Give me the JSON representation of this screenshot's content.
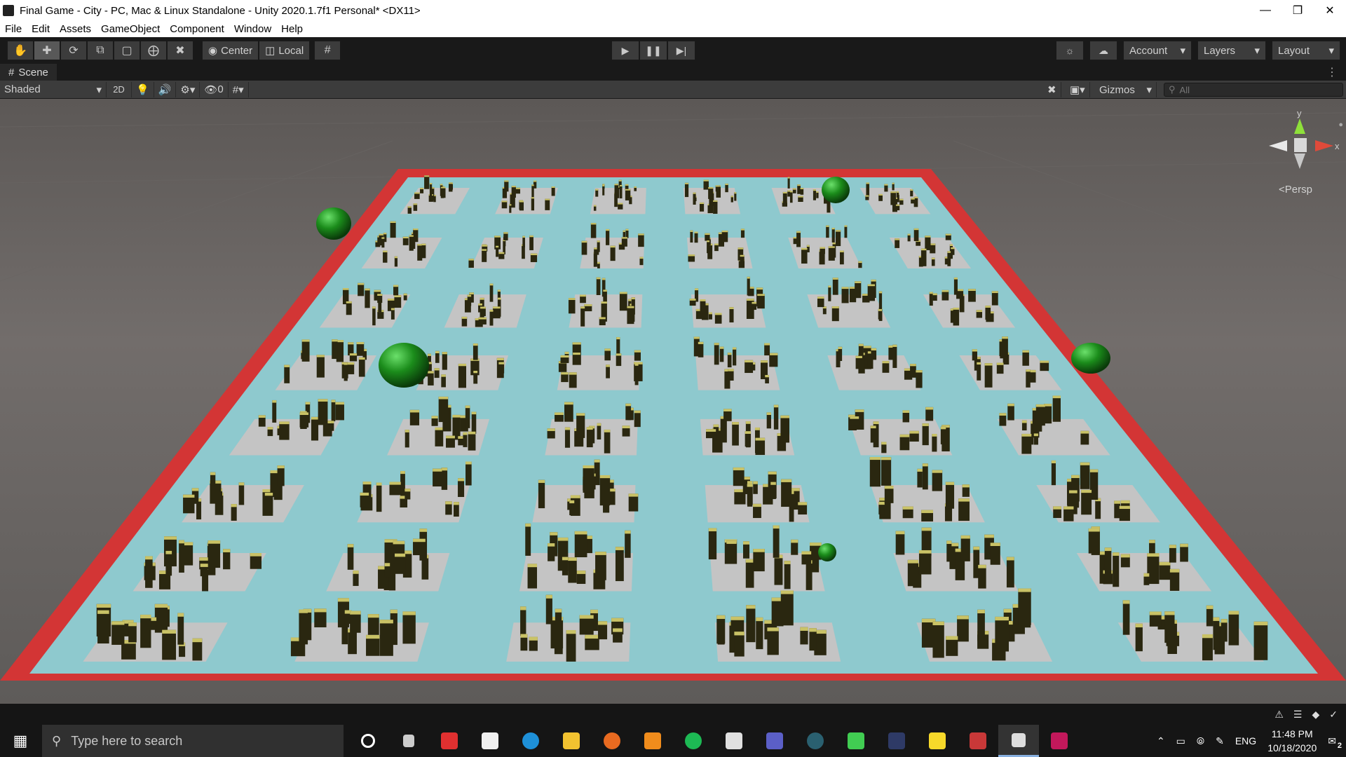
{
  "window": {
    "title": "Final Game - City - PC, Mac & Linux Standalone - Unity 2020.1.7f1 Personal* <DX11>"
  },
  "menu": [
    "File",
    "Edit",
    "Assets",
    "GameObject",
    "Component",
    "Window",
    "Help"
  ],
  "toolbar": {
    "pivot_label": "Center",
    "space_label": "Local",
    "account_label": "Account",
    "layers_label": "Layers",
    "layout_label": "Layout"
  },
  "scene": {
    "tab_label": "Scene",
    "shading_mode": "Shaded",
    "mode_2d": "2D",
    "hidden_count": "0",
    "gizmos_label": "Gizmos",
    "search_placeholder": "All",
    "projection_label": "<Persp",
    "axis_y": "y",
    "axis_x": "x"
  },
  "taskbar": {
    "search_placeholder": "Type here to search",
    "language": "ENG",
    "time": "11:48 PM",
    "date": "10/18/2020",
    "notifications": "2"
  },
  "colors": {
    "editor_bg": "#191919",
    "ground_cyan": "#8ec9ce",
    "block_gray": "#c4c4c4",
    "border_red": "#d33535",
    "building_top": "#c9c266",
    "sphere_green": "#1b8c1b"
  }
}
